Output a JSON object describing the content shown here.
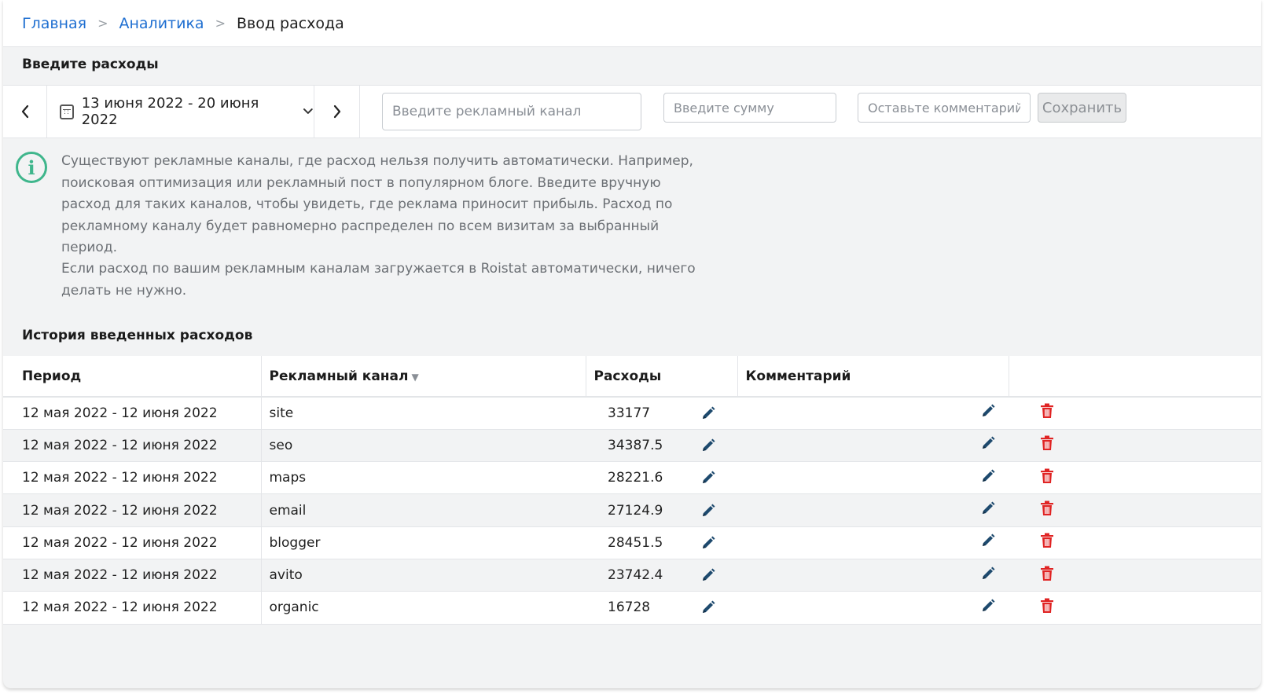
{
  "breadcrumb": {
    "home": "Главная",
    "analytics": "Аналитика",
    "current": "Ввод расхода",
    "separator": ">"
  },
  "enter_section": {
    "title": "Введите расходы",
    "date_range": "13 июня 2022 - 20 июня 2022",
    "prev_icon": "chevron-left-icon",
    "next_icon": "chevron-right-icon",
    "channel_placeholder": "Введите рекламный канал",
    "amount_placeholder": "Введите сумму",
    "comment_placeholder": "Оставьте комментарий",
    "save_label": "Сохранить"
  },
  "info": {
    "paragraph1": "Существуют рекламные каналы, где расход нельзя получить автоматически. Например, поисковая оптимизация или рекламный пост в популярном блоге. Введите вручную расход для таких каналов, чтобы увидеть, где реклама приносит прибыль. Расход по рекламному каналу будет равномерно распределен по всем визитам за выбранный период.",
    "paragraph2": "Если расход по вашим рекламным каналам загружается в Roistat автоматически, ничего делать не нужно.",
    "icon_color": "#3fb68c"
  },
  "history": {
    "title": "История введенных расходов",
    "columns": {
      "period": "Период",
      "channel": "Рекламный канал",
      "amount": "Расходы",
      "comment": "Комментарий"
    },
    "sort_indicator": "▼",
    "rows": [
      {
        "period": "12 мая 2022 - 12 июня 2022",
        "channel": "site",
        "amount": "33177",
        "comment": ""
      },
      {
        "period": "12 мая 2022 - 12 июня 2022",
        "channel": "seo",
        "amount": "34387.5",
        "comment": ""
      },
      {
        "period": "12 мая 2022 - 12 июня 2022",
        "channel": "maps",
        "amount": "28221.6",
        "comment": ""
      },
      {
        "period": "12 мая 2022 - 12 июня 2022",
        "channel": "email",
        "amount": "27124.9",
        "comment": ""
      },
      {
        "period": "12 мая 2022 - 12 июня 2022",
        "channel": "blogger",
        "amount": "28451.5",
        "comment": ""
      },
      {
        "period": "12 мая 2022 - 12 июня 2022",
        "channel": "avito",
        "amount": "23742.4",
        "comment": ""
      },
      {
        "period": "12 мая 2022 - 12 июня 2022",
        "channel": "organic",
        "amount": "16728",
        "comment": ""
      }
    ],
    "edit_icon_color": "#1e4a6e",
    "delete_icon_color": "#e02424"
  }
}
